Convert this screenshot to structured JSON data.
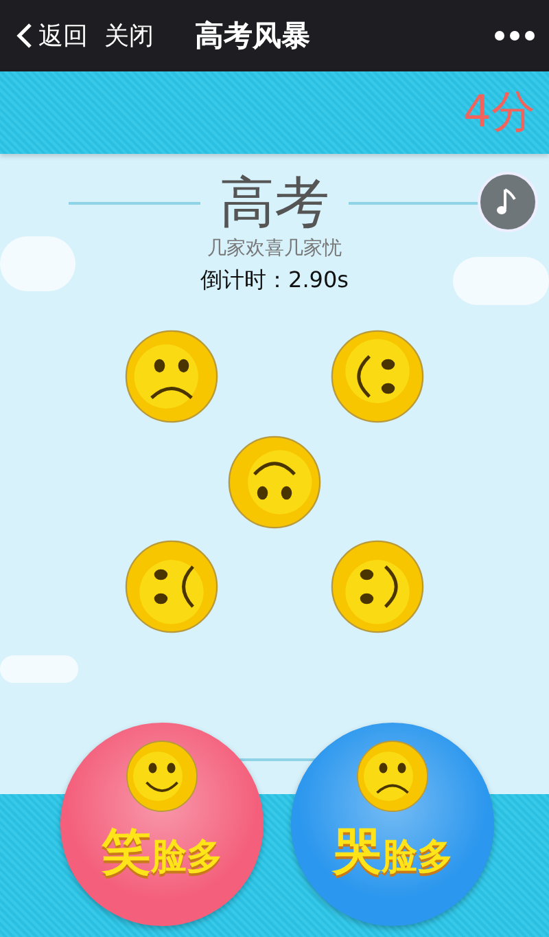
{
  "nav": {
    "back": "返回",
    "close": "关闭",
    "title": "高考风暴"
  },
  "score": "4分",
  "heading": {
    "title": "高考",
    "subtitle": "几家欢喜几家忧",
    "countdown": "倒计时：2.90s"
  },
  "faces": [
    {
      "kind": "frownup"
    },
    {
      "kind": "smileright"
    },
    {
      "kind": "smiledown"
    },
    {
      "kind": "frownleft"
    },
    {
      "kind": "smileleft"
    }
  ],
  "answer_buttons": [
    {
      "kind": "smile",
      "label": "笑脸多",
      "color": "#f4607c"
    },
    {
      "kind": "frown",
      "label": "哭脸多",
      "color": "#2b97ee"
    }
  ]
}
